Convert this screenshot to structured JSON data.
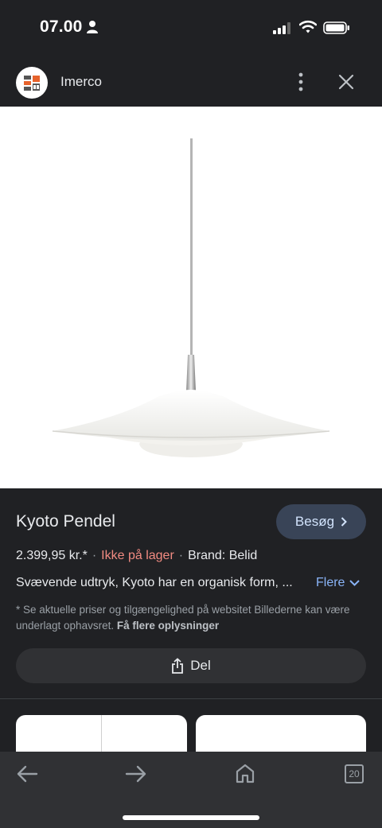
{
  "status_bar": {
    "time": "07.00"
  },
  "header": {
    "site_name": "Imerco"
  },
  "product": {
    "title": "Kyoto Pendel",
    "visit_label": "Besøg",
    "price": "2.399,95 kr.*",
    "stock": "Ikke på lager",
    "brand": "Brand: Belid",
    "description": "Svævende udtryk, Kyoto har en organisk form, ...",
    "more_label": "Flere",
    "disclaimer": "* Se aktuelle priser og tilgængelighed på websitet Billederne kan være underlagt ophavsret.",
    "more_info_label": "Få flere oplysninger",
    "share_label": "Del"
  },
  "nav": {
    "tab_count": "20"
  },
  "colors": {
    "background": "#202124",
    "accent_link": "#8ab4f8",
    "stock_red": "#f28b82",
    "visit_button": "#394457"
  },
  "icons": [
    "person-icon",
    "signal-icon",
    "wifi-icon",
    "battery-icon",
    "more-vert-icon",
    "close-icon",
    "chevron-right-icon",
    "chevron-down-icon",
    "share-icon",
    "back-arrow-icon",
    "forward-arrow-icon",
    "home-icon",
    "tabs-icon"
  ]
}
